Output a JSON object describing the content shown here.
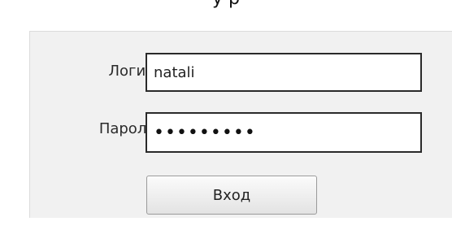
{
  "caption": "у                                           р",
  "form": {
    "login_label": "Логин:",
    "login_value": "natali",
    "password_label": "Пароль:",
    "password_value": "•••••••••",
    "submit_label": "Вход"
  }
}
